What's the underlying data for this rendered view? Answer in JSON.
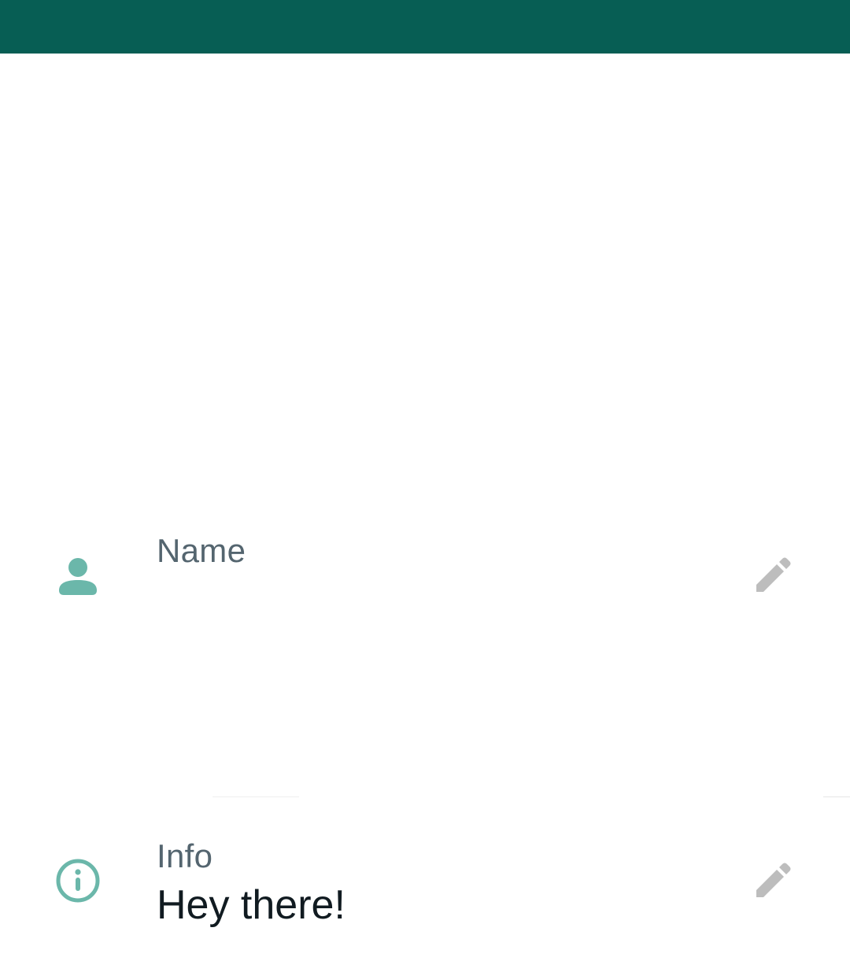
{
  "colors": {
    "app_bar": "#075e54",
    "accent_icon": "#6bb7aa",
    "label_text": "#54656f",
    "value_text": "#111b21",
    "edit_icon": "#bdbdbd"
  },
  "profile": {
    "name_row": {
      "label": "Name",
      "value": "",
      "icon": "person-icon",
      "action_icon": "pencil-icon"
    },
    "info_row": {
      "label": "Info",
      "value": "Hey there!",
      "icon": "info-icon",
      "action_icon": "pencil-icon"
    }
  }
}
